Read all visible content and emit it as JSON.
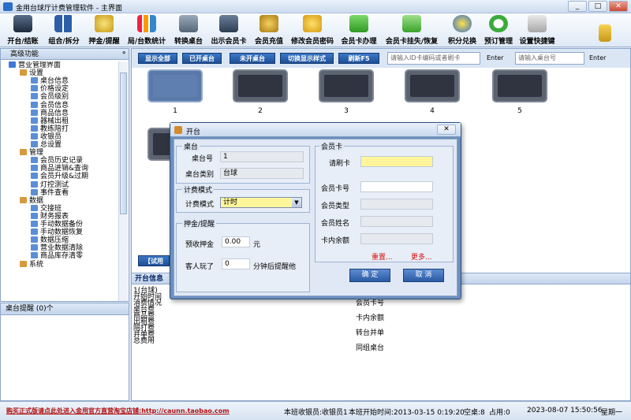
{
  "window": {
    "title": "金用台球厅计费管理软件 - 主界面",
    "min": "_",
    "max": "□",
    "close": "✕"
  },
  "toolbar": {
    "items": [
      {
        "label": "开台/结账",
        "icon": "monitor-icon"
      },
      {
        "label": "组合/拆分",
        "icon": "grid-icon"
      },
      {
        "label": "押金/提醒",
        "icon": "coin-icon"
      },
      {
        "label": "局/台数统计",
        "icon": "bar-chart-icon"
      },
      {
        "label": "转换桌台",
        "icon": "swap-icon"
      },
      {
        "label": "出示会员卡",
        "icon": "card-icon"
      },
      {
        "label": "会员充值",
        "icon": "coins-icon"
      },
      {
        "label": "修改会员密码",
        "icon": "key-icon"
      },
      {
        "label": "会员卡办理",
        "icon": "add-card-icon"
      },
      {
        "label": "会员卡挂失/恢复",
        "icon": "play-icon"
      },
      {
        "label": "积分兑换",
        "icon": "star-icon"
      },
      {
        "label": "预订管理",
        "icon": "clock-icon"
      },
      {
        "label": "设置快捷键",
        "icon": "keyboard-icon"
      }
    ]
  },
  "left_panel": {
    "title": "高级功能",
    "pin": "ᵠ",
    "tree": [
      {
        "label": "营业管理界面",
        "level": 0,
        "color": "#3d7bd6"
      },
      {
        "label": "设置",
        "level": 1,
        "color": "#d69a3d"
      },
      {
        "label": "桌台信息",
        "level": 2,
        "color": "#5a8fd8"
      },
      {
        "label": "价格设定",
        "level": 2,
        "color": "#5a8fd8"
      },
      {
        "label": "会员级别",
        "level": 2,
        "color": "#5a8fd8"
      },
      {
        "label": "会员信息",
        "level": 2,
        "color": "#5a8fd8"
      },
      {
        "label": "商品信息",
        "level": 2,
        "color": "#5a8fd8"
      },
      {
        "label": "器械出租",
        "level": 2,
        "color": "#5a8fd8"
      },
      {
        "label": "教练陪打",
        "level": 2,
        "color": "#5a8fd8"
      },
      {
        "label": "收银员",
        "level": 2,
        "color": "#5a8fd8"
      },
      {
        "label": "总设置",
        "level": 2,
        "color": "#5a8fd8"
      },
      {
        "label": "管理",
        "level": 1,
        "color": "#d69a3d"
      },
      {
        "label": "会员历史记录",
        "level": 2,
        "color": "#5a8fd8"
      },
      {
        "label": "商品进销&查询",
        "level": 2,
        "color": "#5a8fd8"
      },
      {
        "label": "会员升级&过期",
        "level": 2,
        "color": "#5a8fd8"
      },
      {
        "label": "灯控测试",
        "level": 2,
        "color": "#5a8fd8"
      },
      {
        "label": "事件查看",
        "level": 2,
        "color": "#5a8fd8"
      },
      {
        "label": "数据",
        "level": 1,
        "color": "#d69a3d"
      },
      {
        "label": "交接班",
        "level": 2,
        "color": "#5a8fd8"
      },
      {
        "label": "财务报表",
        "level": 2,
        "color": "#5a8fd8"
      },
      {
        "label": "手动数据备份",
        "level": 2,
        "color": "#5a8fd8"
      },
      {
        "label": "手动数据恢复",
        "level": 2,
        "color": "#5a8fd8"
      },
      {
        "label": "数据压缩",
        "level": 2,
        "color": "#5a8fd8"
      },
      {
        "label": "营业数据清除",
        "level": 2,
        "color": "#5a8fd8"
      },
      {
        "label": "商品库存清零",
        "level": 2,
        "color": "#5a8fd8"
      },
      {
        "label": "系统",
        "level": 1,
        "color": "#d69a3d"
      }
    ]
  },
  "reminder": {
    "title": "桌台提醒 (0)个"
  },
  "filter": {
    "buttons": [
      "显示全部",
      "已开桌台",
      "未开桌台",
      "切换显示样式",
      "刷新F5"
    ],
    "card_placeholder": "请输入ID卡编码或者刷卡",
    "table_placeholder": "请输入桌台号",
    "enter": "Enter"
  },
  "tables": [
    {
      "num": "1",
      "selected": true
    },
    {
      "num": "2",
      "selected": false
    },
    {
      "num": "3",
      "selected": false
    },
    {
      "num": "4",
      "selected": false
    },
    {
      "num": "5",
      "selected": false
    },
    {
      "num": "",
      "selected": false
    },
    {
      "num": "",
      "selected": false
    }
  ],
  "hidden_button": "【试用",
  "info_panel": {
    "title": "开台信息",
    "left_lines": [
      "1(台球)",
      "开始时间",
      "消费情况",
      "桌台费",
      "商品费",
      "出租费",
      "陪打费",
      "并单费",
      "总费用"
    ],
    "right_lines": [
      "会员卡号",
      "卡内余额",
      "转台并单",
      "同组桌台"
    ]
  },
  "dialog": {
    "title": "开台",
    "close": "✕",
    "table_group": "桌台",
    "table_no_label": "桌台号",
    "table_no": "1",
    "table_type_label": "桌台类别",
    "table_type": "台球",
    "billing_group": "计费模式",
    "billing_label": "计费模式",
    "billing_value": "计时",
    "deposit_group": "押金/提醒",
    "deposit_label": "预收押金",
    "deposit_value": "0.00",
    "deposit_unit": "元",
    "remind_label": "客人玩了",
    "remind_value": "0",
    "remind_unit": "分钟后提醒他",
    "member_group": "会员卡",
    "swipe_label": "请刷卡",
    "swipe_value": "",
    "card_no_label": "会员卡号",
    "card_type_label": "会员类型",
    "name_label": "会员姓名",
    "balance_label": "卡内余额",
    "reset": "重置...",
    "more": "更多...",
    "ok": "确 定",
    "cancel": "取 消"
  },
  "status": {
    "promo": "购买正式版请点此处进入金用官方直营淘宝店铺:http://caunn.taobao.com",
    "cashier": "本班收银员:收银员1",
    "shift_start": "本班开始时间:2013-03-15 0:19:20",
    "free": "空桌:8",
    "used": "占用:0",
    "clock": "2023-08-07 15:50:56",
    "weekday": "星期一"
  }
}
